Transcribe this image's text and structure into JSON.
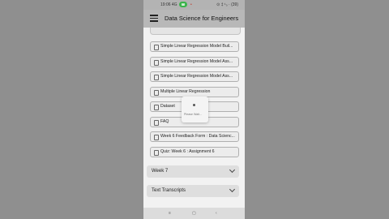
{
  "status_bar": {
    "time": "19:06 4G",
    "right": "⊙ ‡ ¹₀ · (39)"
  },
  "app_bar": {
    "title": "Data Science for Engineers"
  },
  "list": {
    "items": [
      "Simple Linear Regression Model Buil...",
      "Simple Linear Regression Model Ass...",
      "Simple Linear Regression Model Ass...",
      "Multiple Linear Regression",
      "Dataset",
      "FAQ",
      "Week 6 Feedback Form : Data Scienc...",
      "Quiz: Week 6 : Assignment 6"
    ],
    "sections": [
      "Week 7",
      "Text Transcripts"
    ]
  },
  "loading": {
    "text": "Please Wait..."
  },
  "nav": {
    "menu": "≡",
    "home": "▢",
    "back": "‹"
  }
}
